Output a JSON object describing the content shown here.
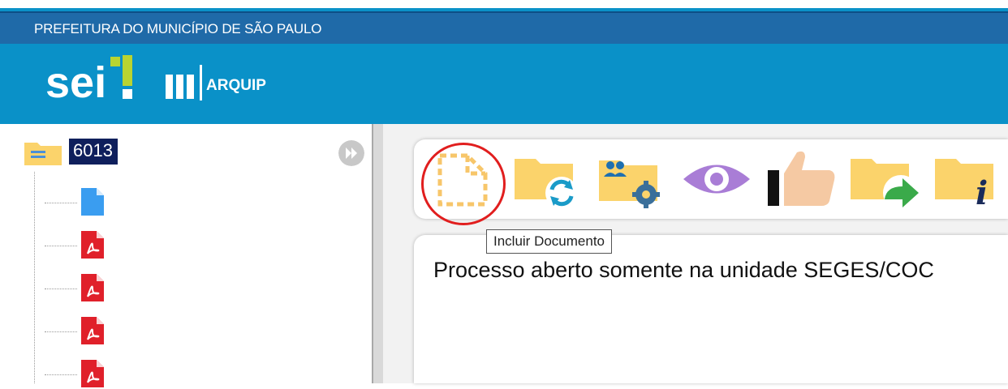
{
  "header": {
    "government_title": "PREFEITURA DO MUNICÍPIO DE SÃO PAULO",
    "logo_text": "sei",
    "system_name": "ARQUIP"
  },
  "tree": {
    "process_number": "6013",
    "items": [
      {
        "icon": "document-icon",
        "color": "#3a9df0"
      },
      {
        "icon": "pdf-icon",
        "color": "#e0202a"
      },
      {
        "icon": "pdf-icon",
        "color": "#e0202a"
      },
      {
        "icon": "pdf-icon",
        "color": "#e0202a"
      },
      {
        "icon": "pdf-icon",
        "color": "#e0202a"
      }
    ]
  },
  "toolbar": {
    "icons": [
      "incluir-documento-icon",
      "folder-sync-icon",
      "folder-users-gear-icon",
      "eye-icon",
      "thumbs-up-icon",
      "folder-send-icon",
      "folder-info-icon"
    ]
  },
  "tooltip": {
    "text": "Incluir Documento"
  },
  "content": {
    "status_text": "Processo aberto somente na unidade SEGES/COC"
  },
  "colors": {
    "header_blue": "#0a91c8",
    "gov_bar": "#1f6aa8",
    "folder_yellow": "#fbd36b",
    "highlight_red": "#e11e1e",
    "process_label_bg": "#0f1f5c"
  }
}
